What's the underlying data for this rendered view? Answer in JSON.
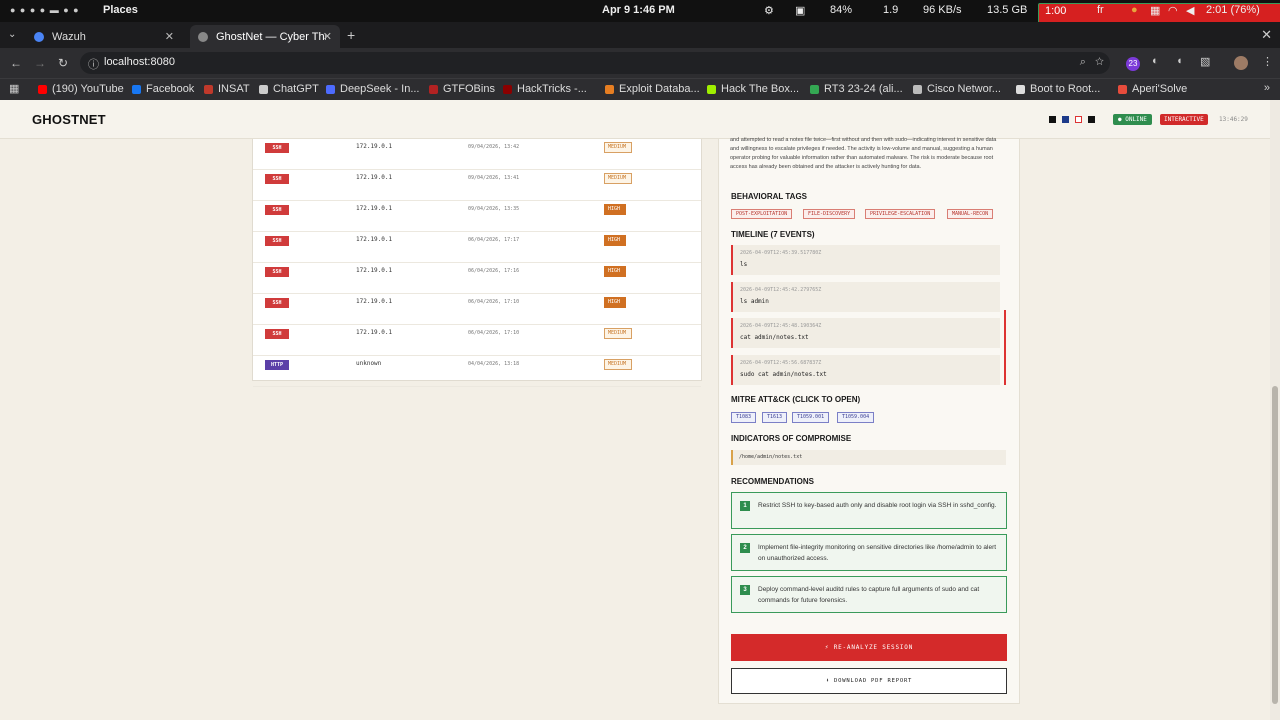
{
  "os_bar": {
    "places": "Places",
    "clock": "Apr 9   1:46 PM",
    "battery": "84%",
    "load": "1.9",
    "net": "96 KB/s",
    "disk": "13.5 GB",
    "rec_time": "1:00",
    "lang": "fr",
    "battery_time": "2:01 (76%)"
  },
  "tabs": [
    {
      "title": "Wazuh"
    },
    {
      "title": "GhostNet — Cyber Thr"
    }
  ],
  "address": {
    "url": "localhost:8080"
  },
  "bookmarks": [
    {
      "label": "(190) YouTube",
      "color": "#ff0000"
    },
    {
      "label": "Facebook",
      "color": "#1877f2"
    },
    {
      "label": "INSAT",
      "color": "#c0392b"
    },
    {
      "label": "ChatGPT",
      "color": "#cccccc"
    },
    {
      "label": "DeepSeek - In...",
      "color": "#4d6bfe"
    },
    {
      "label": "GTFOBins",
      "color": "#b22222"
    },
    {
      "label": "HackTricks -...",
      "color": "#8b0000"
    },
    {
      "label": "Exploit Databa...",
      "color": "#e67e22"
    },
    {
      "label": "Hack The Box...",
      "color": "#9fef00"
    },
    {
      "label": "RT3 23-24 (ali...",
      "color": "#34a853"
    },
    {
      "label": "Cisco Networ...",
      "color": "#bbbbbb"
    },
    {
      "label": "Boot to Root...",
      "color": "#dddddd"
    },
    {
      "label": "Aperi'Solve",
      "color": "#e74c3c"
    }
  ],
  "header": {
    "logo": "GHOSTNET",
    "online": "● ONLINE",
    "interactive": "INTERACTIVE",
    "time": "13:46:29"
  },
  "sessions": [
    {
      "proto": "SSH",
      "ip": "172.19.0.1",
      "date": "09/04/2026, 13:42",
      "risk": "MEDIUM",
      "level": "medium"
    },
    {
      "proto": "SSH",
      "ip": "172.19.0.1",
      "date": "09/04/2026, 13:41",
      "risk": "MEDIUM",
      "level": "medium"
    },
    {
      "proto": "SSH",
      "ip": "172.19.0.1",
      "date": "09/04/2026, 13:35",
      "risk": "HIGH",
      "level": "high"
    },
    {
      "proto": "SSH",
      "ip": "172.19.0.1",
      "date": "06/04/2026, 17:17",
      "risk": "HIGH",
      "level": "high"
    },
    {
      "proto": "SSH",
      "ip": "172.19.0.1",
      "date": "06/04/2026, 17:16",
      "risk": "HIGH",
      "level": "high"
    },
    {
      "proto": "SSH",
      "ip": "172.19.0.1",
      "date": "06/04/2026, 17:10",
      "risk": "HIGH",
      "level": "high"
    },
    {
      "proto": "SSH",
      "ip": "172.19.0.1",
      "date": "06/04/2026, 17:10",
      "risk": "MEDIUM",
      "level": "medium"
    },
    {
      "proto": "HTTP",
      "ip": "unknown",
      "date": "04/04/2026, 13:18",
      "risk": "MEDIUM",
      "level": "medium"
    }
  ],
  "detail": {
    "summary": "and attempted to read a notes file twice—first without and then with sudo—indicating interest in sensitive data and willingness to escalate privileges if needed. The activity is low-volume and manual, suggesting a human operator probing for valuable information rather than automated malware. The risk is moderate because root access has already been obtained and the attacker is actively hunting for data.",
    "tags_title": "BEHAVIORAL TAGS",
    "tags": [
      "POST-EXPLOITATION",
      "FILE-DISCOVERY",
      "PRIVILEGE-ESCALATION",
      "MANUAL-RECON"
    ],
    "timeline_title": "TIMELINE (7 EVENTS)",
    "events": [
      {
        "ts": "2026-04-09T12:45:39.517780Z",
        "cmd": "ls"
      },
      {
        "ts": "2026-04-09T12:45:42.279765Z",
        "cmd": "ls admin"
      },
      {
        "ts": "2026-04-09T12:45:48.190364Z",
        "cmd": "cat admin/notes.txt"
      },
      {
        "ts": "2026-04-09T12:45:56.687837Z",
        "cmd": "sudo cat admin/notes.txt"
      }
    ],
    "mitre_title": "MITRE ATT&CK (CLICK TO OPEN)",
    "mitre": [
      "T1083",
      "T1613",
      "T1059.001",
      "T1059.004"
    ],
    "ioc_title": "INDICATORS OF COMPROMISE",
    "ioc": "/home/admin/notes.txt",
    "rec_title": "RECOMMENDATIONS",
    "recommendations": [
      {
        "num": "1",
        "text": "Restrict SSH to key-based auth only and disable root login via SSH in sshd_config."
      },
      {
        "num": "2",
        "text": "Implement file-integrity monitoring on sensitive directories like /home/admin to alert on unauthorized access."
      },
      {
        "num": "3",
        "text": "Deploy command-level auditd rules to capture full arguments of sudo and cat commands for future forensics."
      }
    ],
    "reanalyze": "⚡ RE-ANALYZE SESSION",
    "download": "⬇ DOWNLOAD PDF REPORT"
  },
  "colors": {
    "proto_ssh": "#d03b3b",
    "proto_http": "#5b3fa8",
    "accent_red": "#d42a2a",
    "accent_green": "#2f8d4e"
  }
}
